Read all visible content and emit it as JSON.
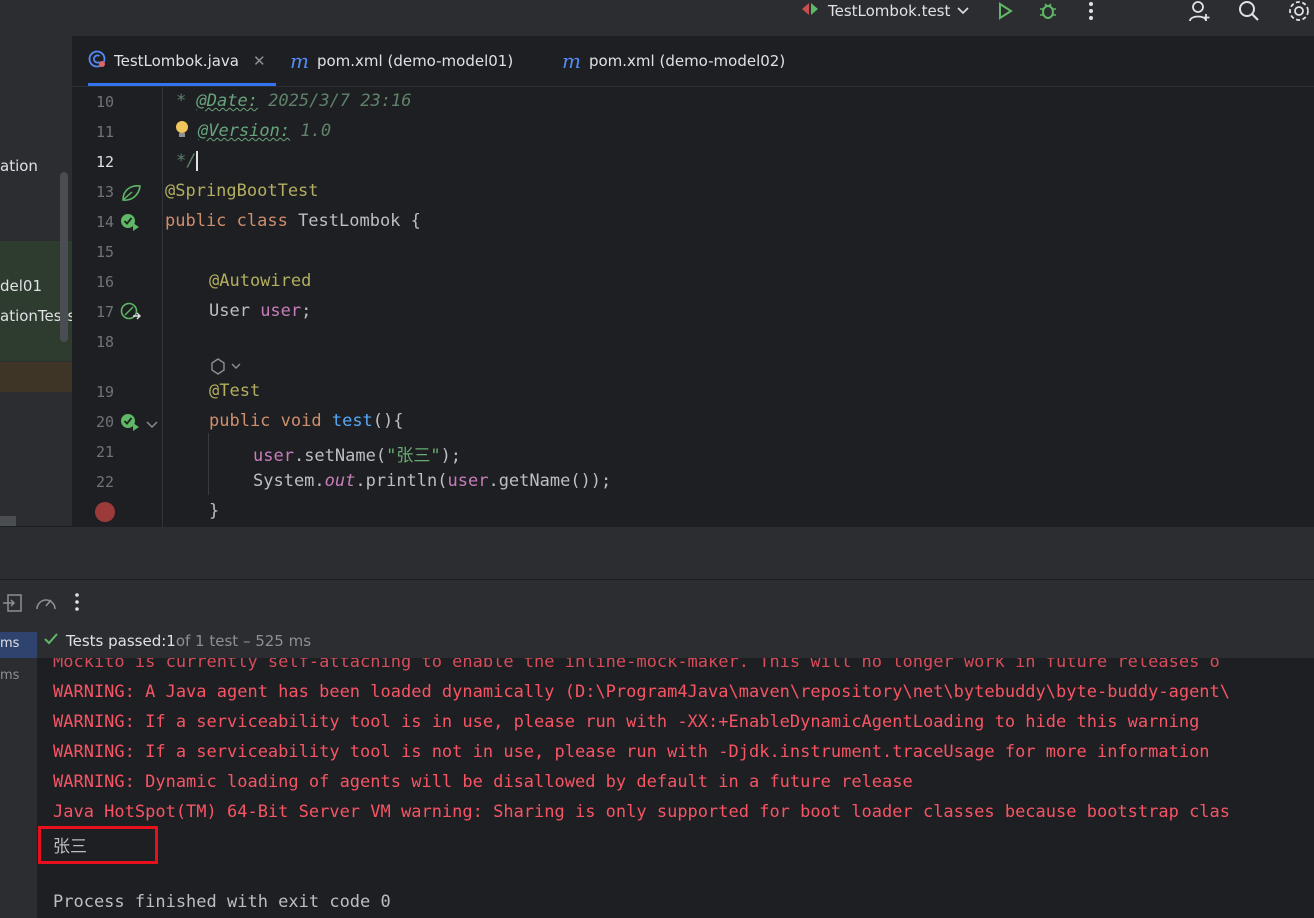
{
  "toolbar": {
    "run_config": "TestLombok.test",
    "icons": [
      "run-config-icon",
      "chevron-down-icon",
      "run-icon",
      "debug-icon",
      "more-icon",
      "add-user-icon",
      "search-icon",
      "settings-icon"
    ]
  },
  "tabs": [
    {
      "label": "TestLombok.java",
      "icon": "java-class-icon",
      "active": true
    },
    {
      "label": "pom.xml (demo-model01)",
      "icon": "maven-icon",
      "active": false
    },
    {
      "label": "pom.xml (demo-model02)",
      "icon": "maven-icon",
      "active": false
    }
  ],
  "project_panel": {
    "rows": [
      "ation",
      "del01",
      "ationTests"
    ]
  },
  "editor": {
    "line_numbers": [
      "10",
      "11",
      "12",
      "13",
      "14",
      "15",
      "16",
      "17",
      "18",
      "19",
      "20",
      "21",
      "22"
    ],
    "current_line": "12",
    "comment_date_tag": "@Date:",
    "comment_date_value": " 2025/3/7 23:16",
    "comment_version_tag": "@Version:",
    "comment_version_value": " 1.0",
    "comment_end": "*/",
    "comment_star": "*",
    "annotation_springboot": "@SpringBootTest",
    "class_kw": "public class",
    "class_name": " TestLombok {",
    "annotation_autowired": "@Autowired",
    "field_type": "User ",
    "field_name": "user",
    "semicolon": ";",
    "annotation_test": "@Test",
    "method_kw": "public void",
    "method_name": "test",
    "method_tail": "(){",
    "stmt1_obj": "user",
    "stmt1_call": ".setName(",
    "stmt1_str": "\"张三\"",
    "stmt1_end": ");",
    "stmt2_a": "System.",
    "stmt2_out": "out",
    "stmt2_b": ".println(",
    "stmt2_user": "user",
    "stmt2_c": ".getName());",
    "closing_brace": "}"
  },
  "test_panel": {
    "status_prefix": "Tests passed: ",
    "status_count": "1",
    "status_suffix": " of 1 test – 525 ms",
    "sidebar_items": [
      "ms",
      "ms"
    ]
  },
  "console": {
    "cutoff_line": "Mockito is currently self-attaching to enable the inline-mock-maker. This will no longer work in future releases o",
    "lines": [
      {
        "text": "WARNING: A Java agent has been loaded dynamically (D:\\Program4Java\\maven\\repository\\net\\bytebuddy\\byte-buddy-agent\\",
        "kind": "warn"
      },
      {
        "text": "WARNING: If a serviceability tool is in use, please run with -XX:+EnableDynamicAgentLoading to hide this warning",
        "kind": "warn"
      },
      {
        "text": "WARNING: If a serviceability tool is not in use, please run with -Djdk.instrument.traceUsage for more information",
        "kind": "warn"
      },
      {
        "text": "WARNING: Dynamic loading of agents will be disallowed by default in a future release",
        "kind": "warn"
      },
      {
        "text": "Java HotSpot(TM) 64-Bit Server VM warning: Sharing is only supported for boot loader classes because bootstrap clas",
        "kind": "warn"
      }
    ],
    "output": "张三",
    "exit_message": "Process finished with exit code 0"
  }
}
